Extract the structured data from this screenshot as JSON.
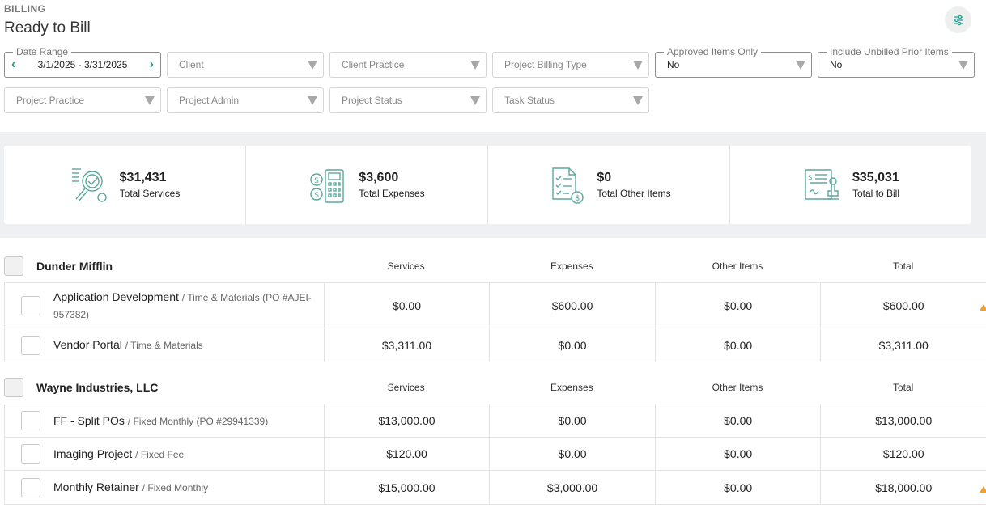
{
  "header": {
    "section": "BILLING",
    "title": "Ready to Bill",
    "settings_icon": "sliders-icon"
  },
  "filters": {
    "date_range": {
      "legend": "Date Range",
      "value": "3/1/2025 - 3/31/2025"
    },
    "client": {
      "placeholder": "Client"
    },
    "client_practice": {
      "placeholder": "Client Practice"
    },
    "project_billing_type": {
      "placeholder": "Project Billing Type"
    },
    "approved_items_only": {
      "legend": "Approved Items Only",
      "value": "No"
    },
    "include_unbilled_prior_items": {
      "legend": "Include Unbilled Prior Items",
      "value": "No"
    },
    "project_practice": {
      "placeholder": "Project Practice"
    },
    "project_admin": {
      "placeholder": "Project Admin"
    },
    "project_status": {
      "placeholder": "Project Status"
    },
    "task_status": {
      "placeholder": "Task Status"
    }
  },
  "summary": [
    {
      "value": "$31,431",
      "label": "Total Services",
      "icon": "services-icon"
    },
    {
      "value": "$3,600",
      "label": "Total Expenses",
      "icon": "expenses-icon"
    },
    {
      "value": "$0",
      "label": "Total Other Items",
      "icon": "other-items-icon"
    },
    {
      "value": "$35,031",
      "label": "Total to Bill",
      "icon": "total-to-bill-icon"
    }
  ],
  "columns": {
    "services": "Services",
    "expenses": "Expenses",
    "other": "Other Items",
    "total": "Total"
  },
  "clients": [
    {
      "name": "Dunder Mifflin",
      "projects": [
        {
          "name": "Application Development",
          "type": "/ Time & Materials (PO #AJEI-957382)",
          "services": "$0.00",
          "expenses": "$600.00",
          "other": "$0.00",
          "total": "$600.00"
        },
        {
          "name": "Vendor Portal",
          "type": "/ Time & Materials",
          "services": "$3,311.00",
          "expenses": "$0.00",
          "other": "$0.00",
          "total": "$3,311.00"
        }
      ]
    },
    {
      "name": "Wayne Industries, LLC",
      "projects": [
        {
          "name": "FF - Split POs",
          "type": "/ Fixed Monthly (PO #29941339)",
          "services": "$13,000.00",
          "expenses": "$0.00",
          "other": "$0.00",
          "total": "$13,000.00"
        },
        {
          "name": "Imaging Project",
          "type": "/ Fixed Fee",
          "services": "$120.00",
          "expenses": "$0.00",
          "other": "$0.00",
          "total": "$120.00"
        },
        {
          "name": "Monthly Retainer",
          "type": "/ Fixed Monthly",
          "services": "$15,000.00",
          "expenses": "$3,000.00",
          "other": "$0.00",
          "total": "$18,000.00"
        }
      ]
    }
  ],
  "colors": {
    "accent": "#2a9d8f",
    "warning": "#f0a030"
  }
}
